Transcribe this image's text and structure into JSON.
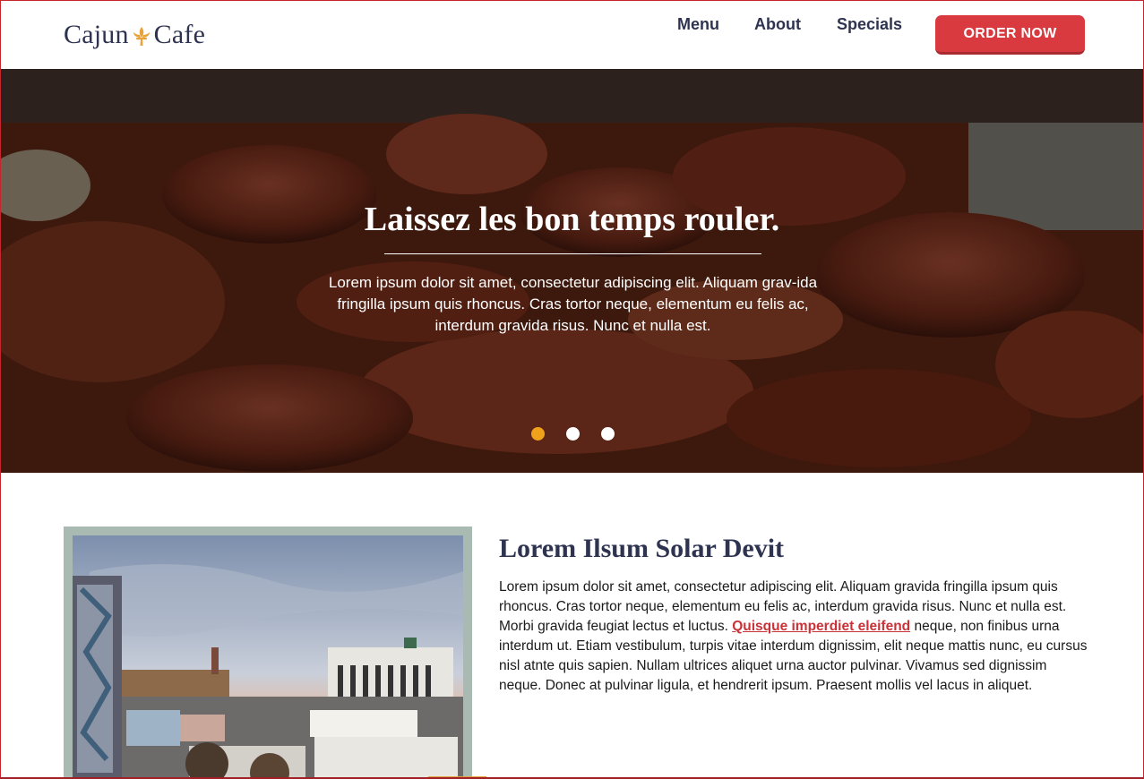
{
  "brand": {
    "name_part1": "Cajun",
    "name_part2": "Cafe",
    "fleur_icon": "fleur-de-lis-icon",
    "accent_color": "#e8a23a",
    "text_color": "#2e3350"
  },
  "nav": {
    "items": [
      {
        "label": "Menu"
      },
      {
        "label": "About"
      },
      {
        "label": "Specials"
      }
    ],
    "order_button": "ORDER NOW",
    "order_color": "#d83a3f"
  },
  "hero": {
    "title": "Laissez les bon temps rouler.",
    "text": "Lorem ipsum dolor sit amet, consectetur adipiscing elit. Aliquam grav-ida fringilla ipsum quis rhoncus. Cras tortor neque, elementum eu felis ac, interdum gravida risus. Nunc et nulla est.",
    "slides": [
      {
        "active": true
      },
      {
        "active": false
      },
      {
        "active": false
      }
    ],
    "active_dot_color": "#f0a11c"
  },
  "section": {
    "title": "Lorem Ilsum Solar Devit",
    "body_before_link": "Lorem ipsum dolor sit amet, consectetur adipiscing elit. Aliquam gravida fringilla ipsum quis rhoncus. Cras tortor neque, elementum eu felis ac, interdum gravida risus. Nunc et nulla est. Morbi gravida feugiat lectus et luctus. ",
    "link_text": "Quisque imperdiet eleifend",
    "body_after_link": " neque, non finibus urna interdum ut. Etiam vestibulum, turpis vitae interdum dignissim, elit neque mattis nunc, eu cursus nisl atnte quis sapien. Nullam ultrices aliquet urna auctor pulvinar. Vivamus sed dignissim neque. Donec at pulvinar ligula, et hendrerit ipsum. Praesent mollis vel lacus in aliquet.",
    "link_color": "#c93338"
  }
}
